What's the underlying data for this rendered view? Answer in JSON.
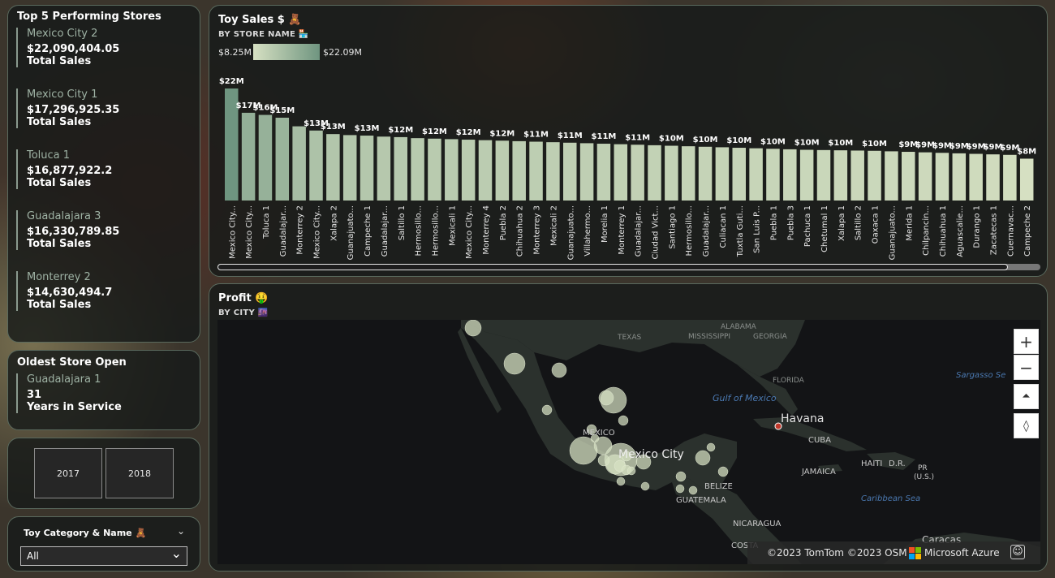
{
  "top_stores": {
    "title": "Top 5 Performing Stores",
    "items": [
      {
        "name": "Mexico City 2",
        "value": "$22,090,404.05",
        "label": "Total Sales"
      },
      {
        "name": "Mexico City 1",
        "value": "$17,296,925.35",
        "label": "Total Sales"
      },
      {
        "name": "Toluca 1",
        "value": "$16,877,922.2",
        "label": "Total Sales"
      },
      {
        "name": "Guadalajara 3",
        "value": "$16,330,789.85",
        "label": "Total Sales"
      },
      {
        "name": "Monterrey 2",
        "value": "$14,630,494.7",
        "label": "Total Sales"
      }
    ]
  },
  "oldest_store": {
    "title": "Oldest Store Open",
    "name": "Guadalajara 1",
    "value": "31",
    "label": "Years in Service"
  },
  "year_slicer": {
    "options": [
      "2017",
      "2018"
    ]
  },
  "category_slicer": {
    "title": "Toy Category & Name 🧸",
    "selected": "All"
  },
  "sales_chart": {
    "title": "Toy Sales $ 🧸",
    "subtitle": "BY STORE NAME 🏪",
    "legend_min": "$8.25M",
    "legend_max": "$22.09M"
  },
  "chart_data": {
    "type": "bar",
    "title": "Toy Sales $",
    "categories": [
      "Mexico City...",
      "Mexico City...",
      "Toluca 1",
      "Guadalajar...",
      "Monterrey 2",
      "Mexico City...",
      "Xalapa 2",
      "Guanajuato...",
      "Campeche 1",
      "Guadalajar...",
      "Saltillo 1",
      "Hermosillo...",
      "Hermosillo...",
      "Mexicali 1",
      "Mexico City...",
      "Monterrey 4",
      "Puebla 2",
      "Chihuahua 2",
      "Monterrey 3",
      "Mexicali 2",
      "Guanajuato...",
      "Villahermo...",
      "Morelia 1",
      "Monterrey 1",
      "Guadalajar...",
      "Ciudad Vict...",
      "Santiago 1",
      "Hermosillo...",
      "Guadalajar...",
      "Culiacan 1",
      "Tuxtla Guti...",
      "San Luis P...",
      "Puebla 1",
      "Puebla 3",
      "Pachuca 1",
      "Chetumal 1",
      "Xalapa 1",
      "Saltillo 2",
      "Oaxaca 1",
      "Guanajuato...",
      "Merida 1",
      "Chilpancin...",
      "Chihuahua 1",
      "Aguascalie...",
      "Durango 1",
      "Zacatecas 1",
      "Cuernavac...",
      "Campeche 2"
    ],
    "values": [
      22.09,
      17.3,
      16.88,
      16.33,
      14.63,
      13.8,
      13.1,
      12.9,
      12.8,
      12.6,
      12.5,
      12.3,
      12.2,
      12.1,
      12.0,
      11.9,
      11.8,
      11.7,
      11.6,
      11.5,
      11.4,
      11.3,
      11.2,
      11.1,
      11.0,
      10.9,
      10.8,
      10.7,
      10.6,
      10.5,
      10.4,
      10.3,
      10.2,
      10.1,
      10.0,
      9.95,
      9.9,
      9.85,
      9.8,
      9.7,
      9.6,
      9.5,
      9.4,
      9.3,
      9.2,
      9.1,
      9.0,
      8.25
    ],
    "data_labels": [
      "$22M",
      "$17M",
      "$16M",
      "$15M",
      "",
      "$13M",
      "$13M",
      "",
      "$13M",
      "",
      "$12M",
      "",
      "$12M",
      "",
      "$12M",
      "",
      "$12M",
      "",
      "$11M",
      "",
      "$11M",
      "",
      "$11M",
      "",
      "$11M",
      "",
      "$10M",
      "",
      "$10M",
      "",
      "$10M",
      "",
      "$10M",
      "",
      "$10M",
      "",
      "$10M",
      "",
      "$10M",
      "",
      "$9M",
      "$9M",
      "$9M",
      "$9M",
      "$9M",
      "$9M",
      "$9M",
      "$8M"
    ],
    "ylabel": "Toy Sales $",
    "xlabel": "BY STORE NAME",
    "ylim": [
      0,
      22.09
    ],
    "colors": {
      "low": "#d6e0c2",
      "high": "#6f9580"
    },
    "grid": false
  },
  "profit_map": {
    "title": "Profit 🤑",
    "subtitle": "BY CITY 🌆",
    "labels": [
      {
        "text": "TEXAS"
      },
      {
        "text": "ALABAMA"
      },
      {
        "text": "MISSISSIPPI"
      },
      {
        "text": "GEORGIA"
      },
      {
        "text": "FLORIDA"
      },
      {
        "text": "Gulf of Mexico"
      },
      {
        "text": "Havana"
      },
      {
        "text": "CUBA"
      },
      {
        "text": "MEXICO"
      },
      {
        "text": "Mexico City"
      },
      {
        "text": "JAMAICA"
      },
      {
        "text": "HAITI"
      },
      {
        "text": "D.R."
      },
      {
        "text": "PR"
      },
      {
        "text": "(U.S.)"
      },
      {
        "text": "BELIZE"
      },
      {
        "text": "GUATEMALA"
      },
      {
        "text": "NICARAGUA"
      },
      {
        "text": "Caribbean Sea"
      },
      {
        "text": "Sargasso Se"
      },
      {
        "text": "Caracas"
      },
      {
        "text": "COSTA"
      }
    ],
    "copyright": "©2023 TomTom  ©2023 OSM",
    "brand": "Microsoft Azure",
    "zoom_in": "+",
    "zoom_out": "−"
  }
}
